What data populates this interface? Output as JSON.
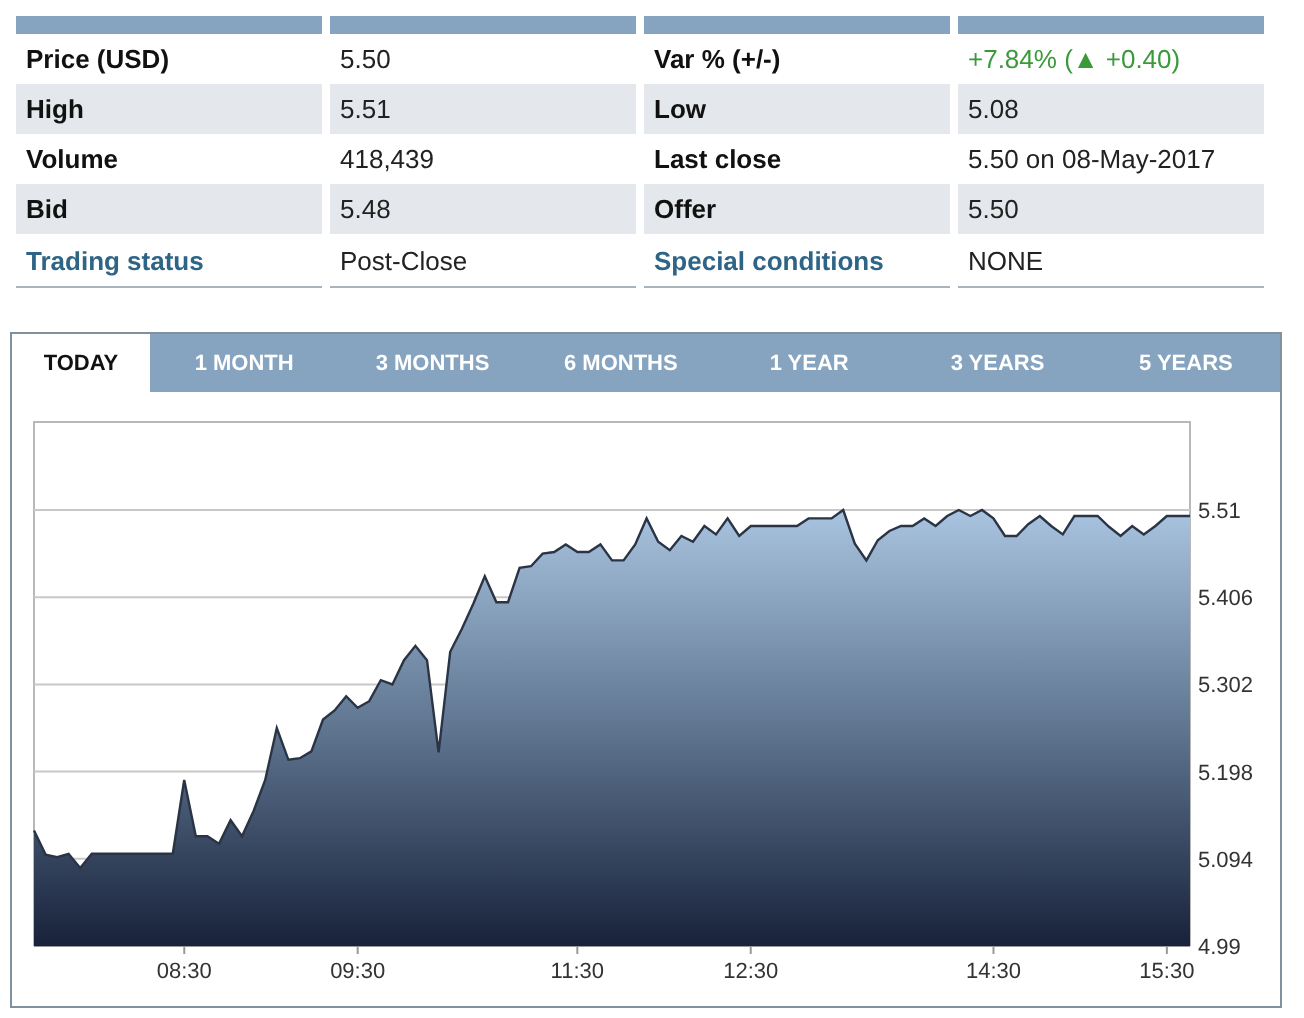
{
  "quote_table": {
    "rows": [
      [
        {
          "kind": "label",
          "text": "Price (USD)"
        },
        {
          "kind": "value",
          "text": "5.50"
        },
        {
          "kind": "label",
          "text": "Var % (+/-)"
        },
        {
          "kind": "change",
          "text": "+7.84% (▲ +0.40)"
        }
      ],
      [
        {
          "kind": "label",
          "text": "High"
        },
        {
          "kind": "value",
          "text": "5.51"
        },
        {
          "kind": "label",
          "text": "Low"
        },
        {
          "kind": "value",
          "text": "5.08"
        }
      ],
      [
        {
          "kind": "label",
          "text": "Volume"
        },
        {
          "kind": "value",
          "text": "418,439"
        },
        {
          "kind": "label",
          "text": "Last close"
        },
        {
          "kind": "value",
          "text": "5.50 on 08-May-2017"
        }
      ],
      [
        {
          "kind": "label",
          "text": "Bid"
        },
        {
          "kind": "value",
          "text": "5.48"
        },
        {
          "kind": "label",
          "text": "Offer"
        },
        {
          "kind": "value",
          "text": "5.50"
        }
      ],
      [
        {
          "kind": "link",
          "text": "Trading status"
        },
        {
          "kind": "value",
          "text": "Post-Close"
        },
        {
          "kind": "link",
          "text": "Special conditions"
        },
        {
          "kind": "value",
          "text": "NONE"
        }
      ]
    ]
  },
  "chart_panel": {
    "tabs": [
      {
        "label": "TODAY",
        "selected": true
      },
      {
        "label": "1 MONTH",
        "selected": false
      },
      {
        "label": "3 MONTHS",
        "selected": false
      },
      {
        "label": "6 MONTHS",
        "selected": false
      },
      {
        "label": "1 YEAR",
        "selected": false
      },
      {
        "label": "3 YEARS",
        "selected": false
      },
      {
        "label": "5 YEARS",
        "selected": false
      }
    ],
    "chart_data": {
      "type": "area",
      "grid": true,
      "ylim": [
        4.99,
        5.615
      ],
      "categories": [
        null,
        null,
        null,
        null,
        null,
        null,
        null,
        null,
        null,
        null,
        null,
        null,
        null,
        "08:30",
        null,
        null,
        null,
        null,
        null,
        null,
        null,
        null,
        null,
        null,
        null,
        null,
        null,
        null,
        "09:30",
        null,
        null,
        null,
        null,
        null,
        null,
        null,
        null,
        null,
        null,
        null,
        null,
        null,
        null,
        null,
        null,
        null,
        null,
        "11:30",
        null,
        null,
        null,
        null,
        null,
        null,
        null,
        null,
        null,
        null,
        null,
        null,
        null,
        null,
        "12:30",
        null,
        null,
        null,
        null,
        null,
        null,
        null,
        null,
        null,
        null,
        null,
        null,
        null,
        null,
        null,
        null,
        null,
        null,
        null,
        null,
        "14:30",
        null,
        null,
        null,
        null,
        null,
        null,
        null,
        null,
        null,
        null,
        null,
        null,
        null,
        null,
        "15:30",
        null,
        null
      ],
      "yticks": [
        4.99,
        5.094,
        5.198,
        5.302,
        5.406,
        5.51
      ],
      "series": [
        {
          "color": "#2a3445",
          "values": [
            5.128,
            5.099,
            5.096,
            5.1,
            5.083,
            5.1,
            5.1,
            5.1,
            5.1,
            5.1,
            5.1,
            5.1,
            5.1,
            5.188,
            5.121,
            5.121,
            5.112,
            5.14,
            5.121,
            5.151,
            5.188,
            5.25,
            5.212,
            5.214,
            5.222,
            5.26,
            5.271,
            5.288,
            5.274,
            5.282,
            5.307,
            5.302,
            5.331,
            5.348,
            5.331,
            5.221,
            5.341,
            5.368,
            5.398,
            5.431,
            5.4,
            5.4,
            5.441,
            5.443,
            5.458,
            5.46,
            5.469,
            5.46,
            5.46,
            5.469,
            5.45,
            5.45,
            5.469,
            5.5,
            5.472,
            5.462,
            5.479,
            5.472,
            5.491,
            5.481,
            5.5,
            5.479,
            5.491,
            5.491,
            5.491,
            5.491,
            5.491,
            5.5,
            5.5,
            5.5,
            5.51,
            5.47,
            5.45,
            5.474,
            5.485,
            5.491,
            5.491,
            5.5,
            5.491,
            5.503,
            5.51,
            5.503,
            5.51,
            5.5,
            5.479,
            5.479,
            5.493,
            5.503,
            5.491,
            5.481,
            5.503,
            5.503,
            5.503,
            5.49,
            5.479,
            5.491,
            5.481,
            5.491,
            5.503,
            5.503,
            5.503
          ]
        }
      ]
    }
  }
}
